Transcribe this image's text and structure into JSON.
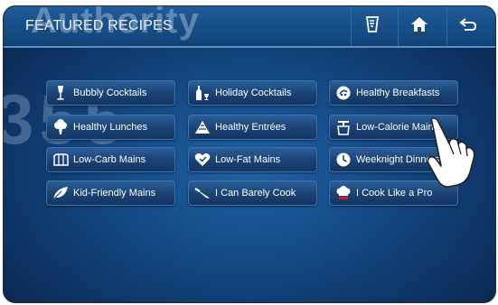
{
  "header": {
    "title": "FEATURED RECIPES",
    "buttons": [
      {
        "icon": "recipe-card-icon"
      },
      {
        "icon": "home-icon"
      },
      {
        "icon": "back-icon"
      }
    ]
  },
  "recipes": [
    {
      "label": "Bubbly Cocktails",
      "icon": "champagne-glass-icon"
    },
    {
      "label": "Holiday Cocktails",
      "icon": "bottle-glass-icon"
    },
    {
      "label": "Healthy Breakfasts",
      "icon": "breakfast-icon"
    },
    {
      "label": "Healthy Lunches",
      "icon": "broccoli-icon"
    },
    {
      "label": "Healthy Entrées",
      "icon": "pyramid-icon"
    },
    {
      "label": "Low-Calorie Mains",
      "icon": "scale-icon"
    },
    {
      "label": "Low-Carb Mains",
      "icon": "bread-icon"
    },
    {
      "label": "Low-Fat Mains",
      "icon": "heart-icon"
    },
    {
      "label": "Weeknight Dinners",
      "icon": "clock-icon"
    },
    {
      "label": "Kid-Friendly Mains",
      "icon": "leaf-icon"
    },
    {
      "label": "I Can Barely Cook",
      "icon": "knife-icon"
    },
    {
      "label": "I Cook Like a Pro",
      "icon": "chef-hat-icon"
    }
  ],
  "watermark": {
    "top_text": "Authority",
    "bottom_text": "355"
  },
  "colors": {
    "header_bg": "#114277",
    "body_bg": "#144a85",
    "button_bg": "#1b4476",
    "text": "#ffffff"
  }
}
